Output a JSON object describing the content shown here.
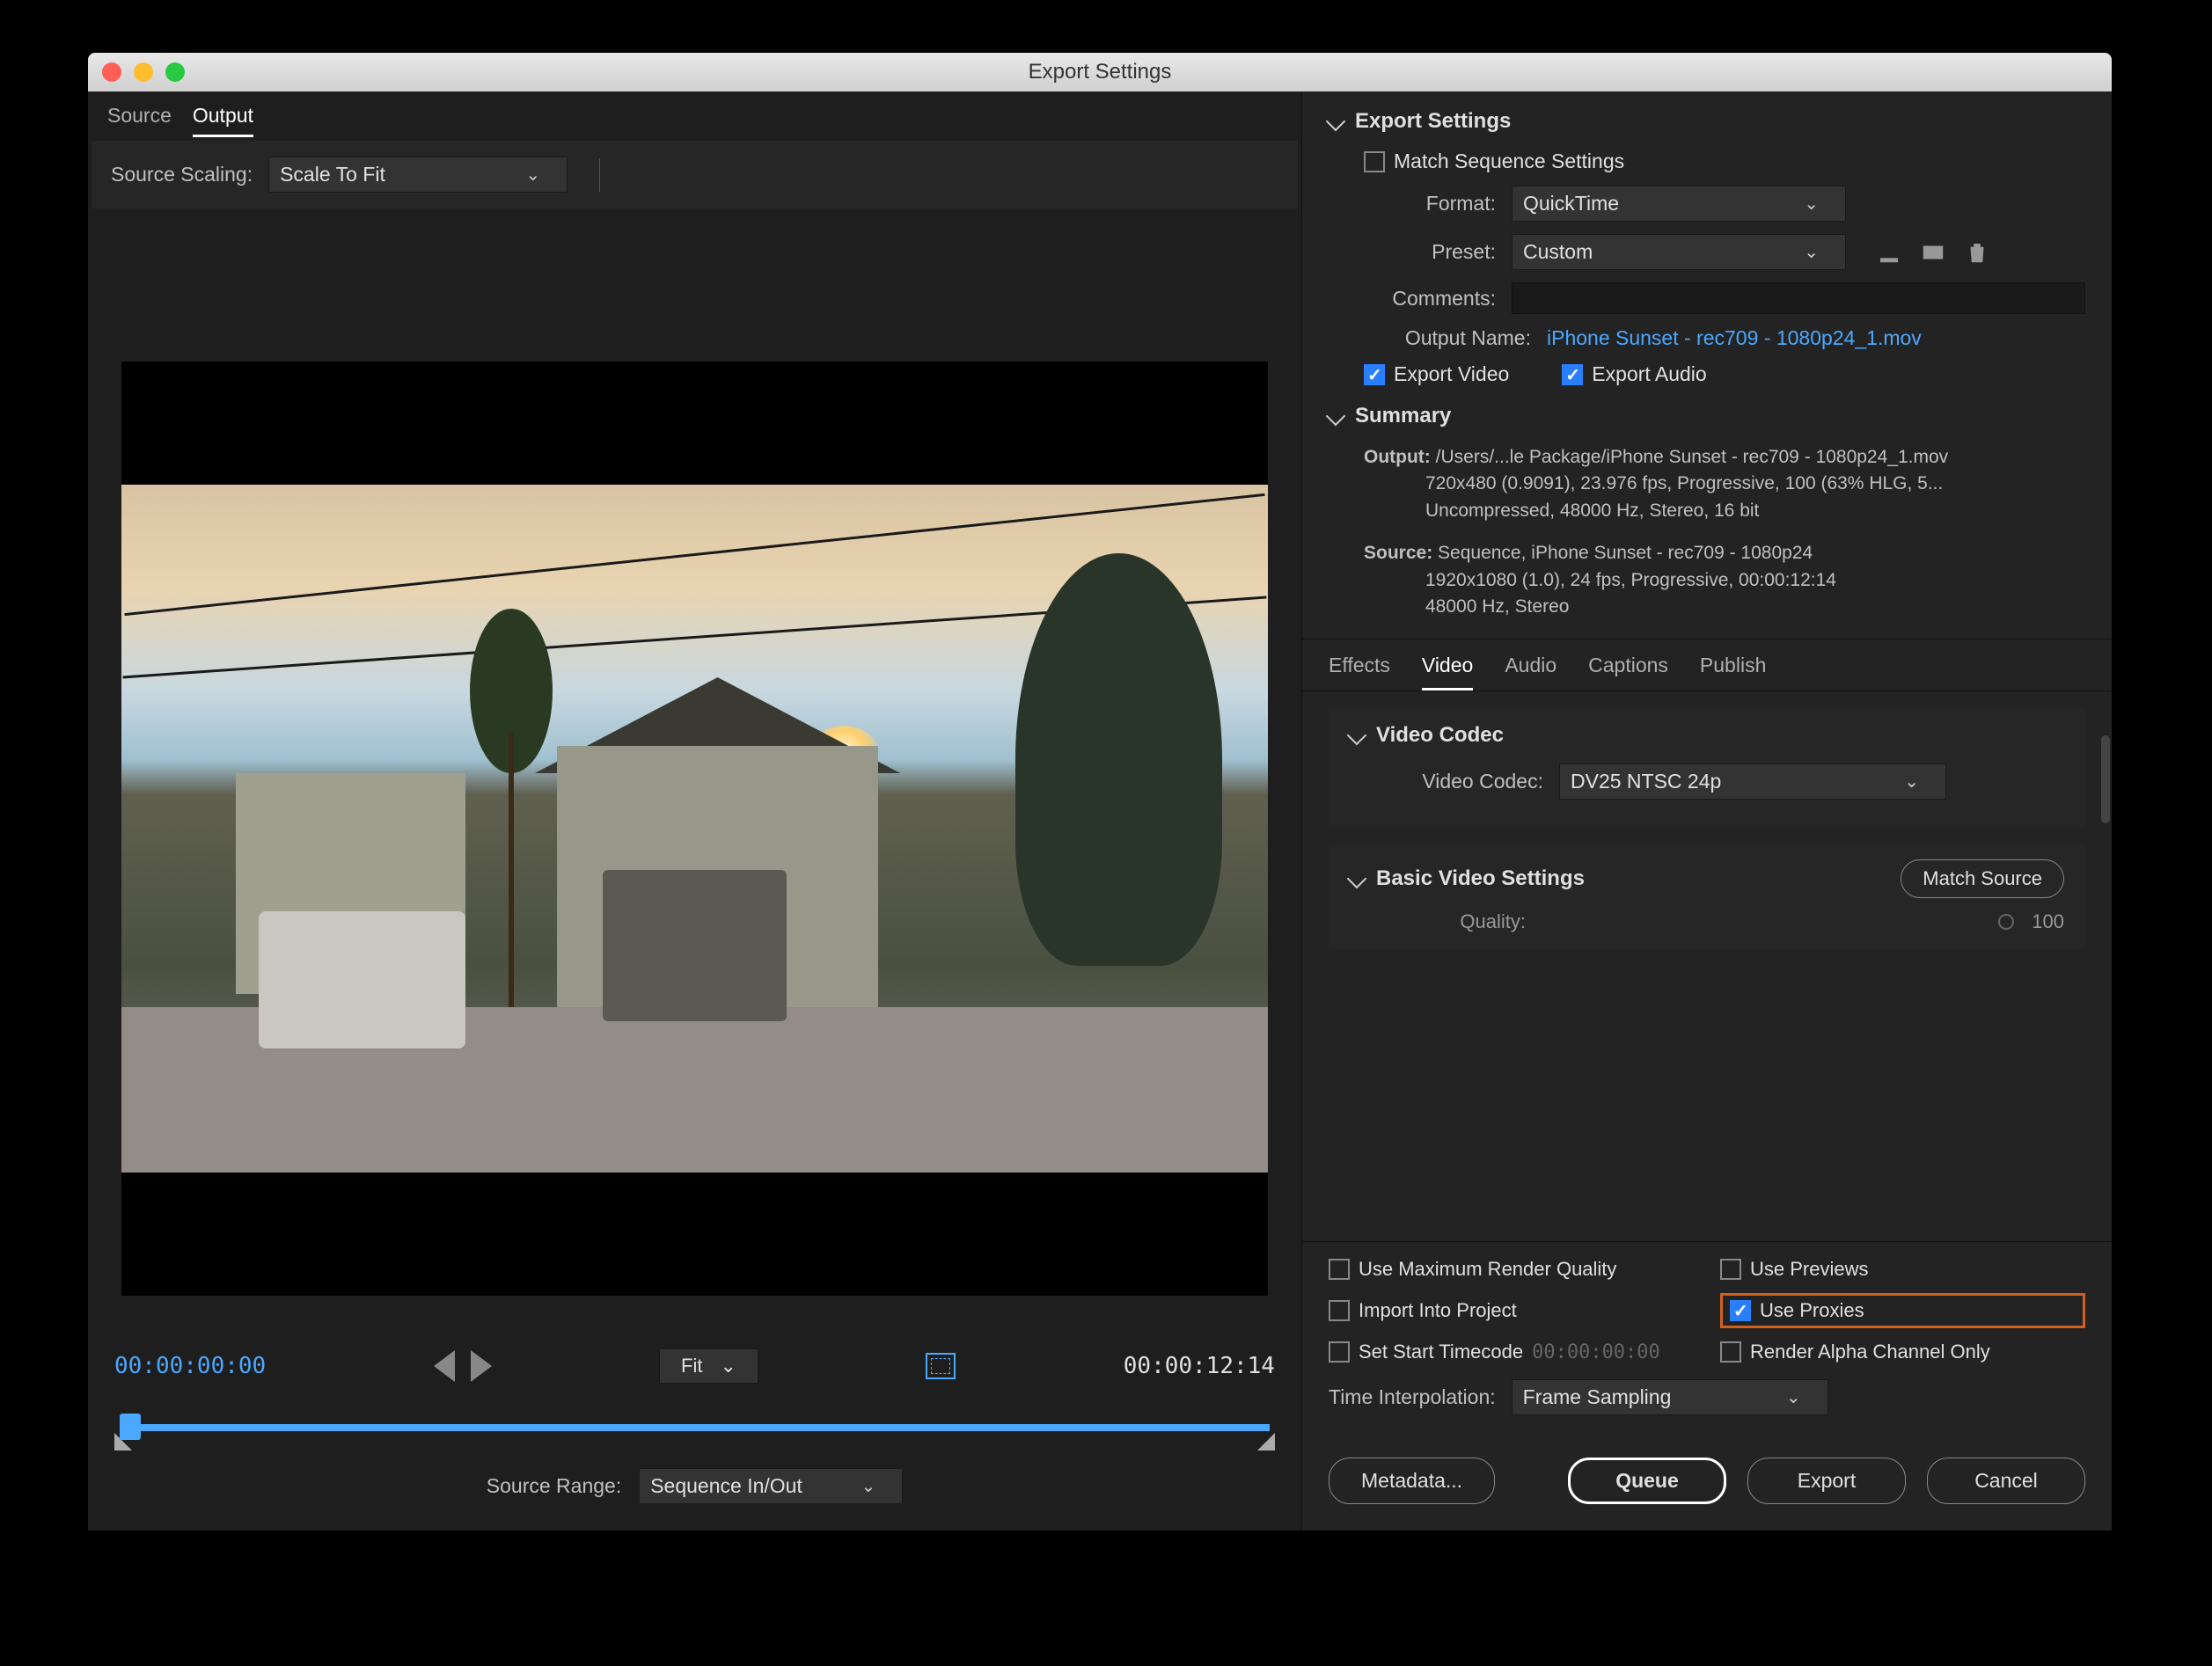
{
  "window": {
    "title": "Export Settings"
  },
  "left": {
    "tabs": {
      "source": "Source",
      "output": "Output"
    },
    "sourceScalingLabel": "Source Scaling:",
    "sourceScalingValue": "Scale To Fit",
    "transport": {
      "currentTime": "00:00:00:00",
      "fit": "Fit",
      "duration": "00:00:12:14",
      "sourceRangeLabel": "Source Range:",
      "sourceRangeValue": "Sequence In/Out"
    }
  },
  "export": {
    "sectionTitle": "Export Settings",
    "matchSequence": "Match Sequence Settings",
    "formatLabel": "Format:",
    "formatValue": "QuickTime",
    "presetLabel": "Preset:",
    "presetValue": "Custom",
    "commentsLabel": "Comments:",
    "outputNameLabel": "Output Name:",
    "outputNameValue": "iPhone Sunset - rec709 - 1080p24_1.mov",
    "exportVideo": "Export Video",
    "exportAudio": "Export Audio",
    "summaryTitle": "Summary",
    "summaryOutputLabel": "Output:",
    "summaryOutput1": "/Users/...le Package/iPhone Sunset - rec709 - 1080p24_1.mov",
    "summaryOutput2": "720x480 (0.9091), 23.976 fps, Progressive, 100 (63% HLG, 5...",
    "summaryOutput3": "Uncompressed, 48000 Hz, Stereo, 16 bit",
    "summarySourceLabel": "Source:",
    "summarySource1": "Sequence, iPhone Sunset - rec709 - 1080p24",
    "summarySource2": "1920x1080 (1.0), 24 fps, Progressive, 00:00:12:14",
    "summarySource3": "48000 Hz, Stereo"
  },
  "subtabs": {
    "effects": "Effects",
    "video": "Video",
    "audio": "Audio",
    "captions": "Captions",
    "publish": "Publish"
  },
  "codec": {
    "sectionTitle": "Video Codec",
    "label": "Video Codec:",
    "value": "DV25 NTSC 24p",
    "basicTitle": "Basic Video Settings",
    "matchSourceBtn": "Match Source",
    "qualityLabel": "Quality:",
    "qualityValue": "100"
  },
  "footer": {
    "maxQuality": "Use Maximum Render Quality",
    "usePreviews": "Use Previews",
    "importProject": "Import Into Project",
    "useProxies": "Use Proxies",
    "setStart": "Set Start Timecode",
    "setStartVal": "00:00:00:00",
    "renderAlpha": "Render Alpha Channel Only",
    "timeInterpLabel": "Time Interpolation:",
    "timeInterpValue": "Frame Sampling"
  },
  "buttons": {
    "metadata": "Metadata...",
    "queue": "Queue",
    "export": "Export",
    "cancel": "Cancel"
  }
}
